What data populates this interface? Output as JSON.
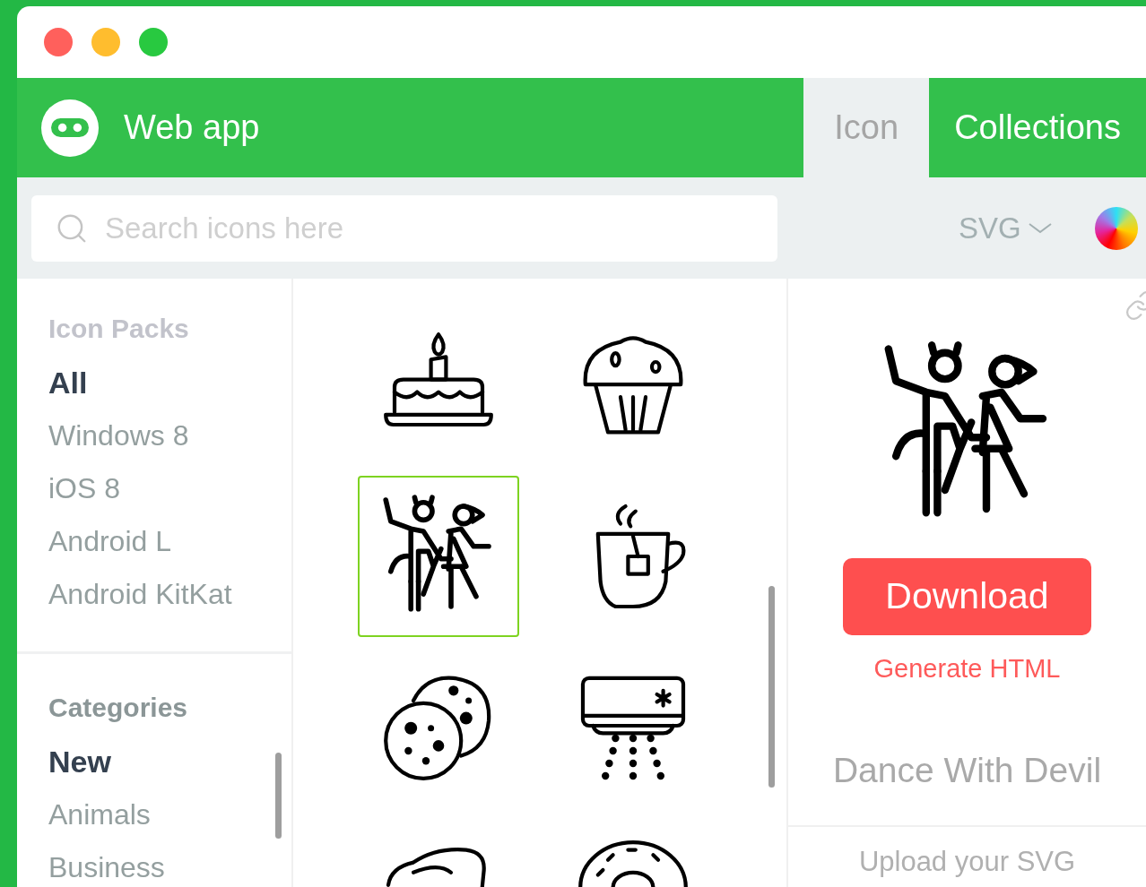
{
  "app": {
    "title": "Web app"
  },
  "tabs": [
    {
      "label": "Icon",
      "selected": true
    },
    {
      "label": "Collections",
      "selected": false
    }
  ],
  "search": {
    "placeholder": "Search icons here"
  },
  "format": {
    "value": "SVG"
  },
  "sidebar": {
    "sections": [
      {
        "title": "Icon Packs",
        "items": [
          {
            "label": "All",
            "selected": true
          },
          {
            "label": "Windows 8",
            "selected": false
          },
          {
            "label": "iOS 8",
            "selected": false
          },
          {
            "label": "Android L",
            "selected": false
          },
          {
            "label": "Android KitKat",
            "selected": false
          }
        ]
      },
      {
        "title": "Categories",
        "items": [
          {
            "label": "New",
            "selected": true
          },
          {
            "label": "Animals",
            "selected": false
          },
          {
            "label": "Business",
            "selected": false
          }
        ]
      }
    ]
  },
  "icons": [
    {
      "selected": false
    },
    {
      "selected": false
    },
    {
      "selected": true
    },
    {
      "selected": false
    },
    {
      "selected": false
    },
    {
      "selected": false
    },
    {
      "selected": false
    },
    {
      "selected": false
    }
  ],
  "detail": {
    "download": "Download",
    "generate": "Generate HTML",
    "name": "Dance With Devil",
    "upload": "Upload your SVG"
  }
}
